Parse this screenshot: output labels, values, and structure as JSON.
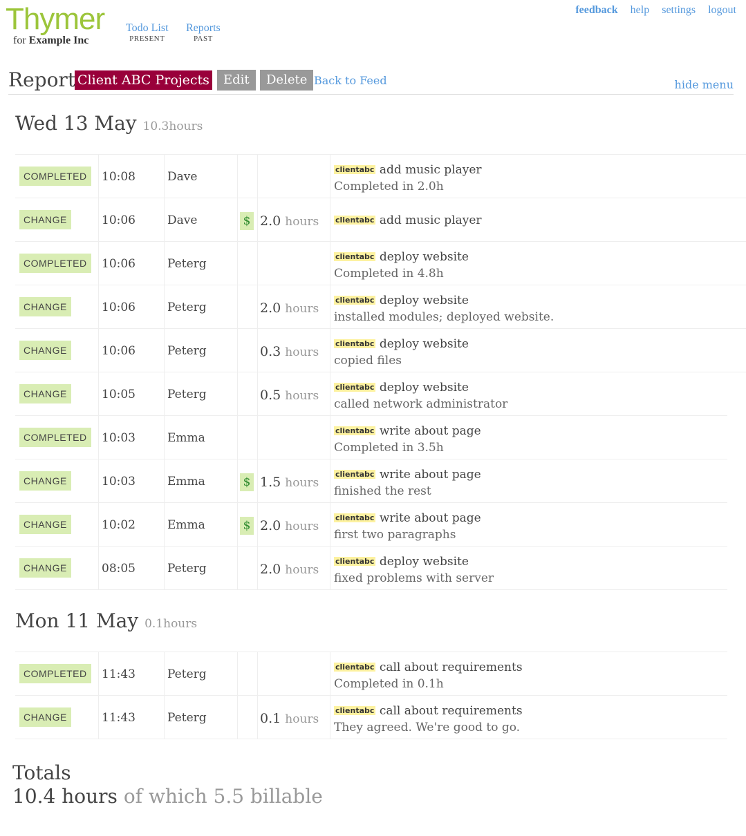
{
  "app": {
    "logo": "Thymer",
    "org_prefix": "for",
    "org_name": "Example Inc"
  },
  "nav": [
    {
      "label": "Todo List",
      "caption": "PRESENT"
    },
    {
      "label": "Reports",
      "caption": "PAST"
    }
  ],
  "toplinks": {
    "feedback": "feedback",
    "help": "help",
    "settings": "settings",
    "logout": "logout"
  },
  "report": {
    "title": "Report",
    "name": "Client ABC Projects",
    "edit_label": "Edit",
    "delete_label": "Delete",
    "back_label": "Back to Feed",
    "hide_menu_label": "hide menu"
  },
  "days": [
    {
      "date": "Wed 13 May",
      "hours": "10.3hours",
      "entries": [
        {
          "type": "COMPLETED",
          "time": "10:08",
          "user": "Dave",
          "billable": false,
          "hours": "",
          "tag": "clientabc",
          "task": "add music player",
          "note": "Completed in 2.0h"
        },
        {
          "type": "CHANGE",
          "time": "10:06",
          "user": "Dave",
          "billable": true,
          "hours": "2.0",
          "tag": "clientabc",
          "task": "add music player",
          "note": ""
        },
        {
          "type": "COMPLETED",
          "time": "10:06",
          "user": "Peterg",
          "billable": false,
          "hours": "",
          "tag": "clientabc",
          "task": "deploy website",
          "note": "Completed in 4.8h"
        },
        {
          "type": "CHANGE",
          "time": "10:06",
          "user": "Peterg",
          "billable": false,
          "hours": "2.0",
          "tag": "clientabc",
          "task": "deploy website",
          "note": "installed modules; deployed website."
        },
        {
          "type": "CHANGE",
          "time": "10:06",
          "user": "Peterg",
          "billable": false,
          "hours": "0.3",
          "tag": "clientabc",
          "task": "deploy website",
          "note": "copied files"
        },
        {
          "type": "CHANGE",
          "time": "10:05",
          "user": "Peterg",
          "billable": false,
          "hours": "0.5",
          "tag": "clientabc",
          "task": "deploy website",
          "note": "called network administrator"
        },
        {
          "type": "COMPLETED",
          "time": "10:03",
          "user": "Emma",
          "billable": false,
          "hours": "",
          "tag": "clientabc",
          "task": "write about page",
          "note": "Completed in 3.5h"
        },
        {
          "type": "CHANGE",
          "time": "10:03",
          "user": "Emma",
          "billable": true,
          "hours": "1.5",
          "tag": "clientabc",
          "task": "write about page",
          "note": "finished the rest"
        },
        {
          "type": "CHANGE",
          "time": "10:02",
          "user": "Emma",
          "billable": true,
          "hours": "2.0",
          "tag": "clientabc",
          "task": "write about page",
          "note": "first two paragraphs"
        },
        {
          "type": "CHANGE",
          "time": "08:05",
          "user": "Peterg",
          "billable": false,
          "hours": "2.0",
          "tag": "clientabc",
          "task": "deploy website",
          "note": "fixed problems with server"
        }
      ]
    },
    {
      "date": "Mon 11 May",
      "hours": "0.1hours",
      "entries": [
        {
          "type": "COMPLETED",
          "time": "11:43",
          "user": "Peterg",
          "billable": false,
          "hours": "",
          "tag": "clientabc",
          "task": "call about requirements",
          "note": "Completed in 0.1h"
        },
        {
          "type": "CHANGE",
          "time": "11:43",
          "user": "Peterg",
          "billable": false,
          "hours": "0.1",
          "tag": "clientabc",
          "task": "call about requirements",
          "note": "They agreed. We're good to go."
        }
      ]
    }
  ],
  "hours_unit": "hours",
  "billable_symbol": "$",
  "totals": {
    "heading": "Totals",
    "hours": "10.4 hours",
    "billable": "of which 5.5 billable"
  }
}
